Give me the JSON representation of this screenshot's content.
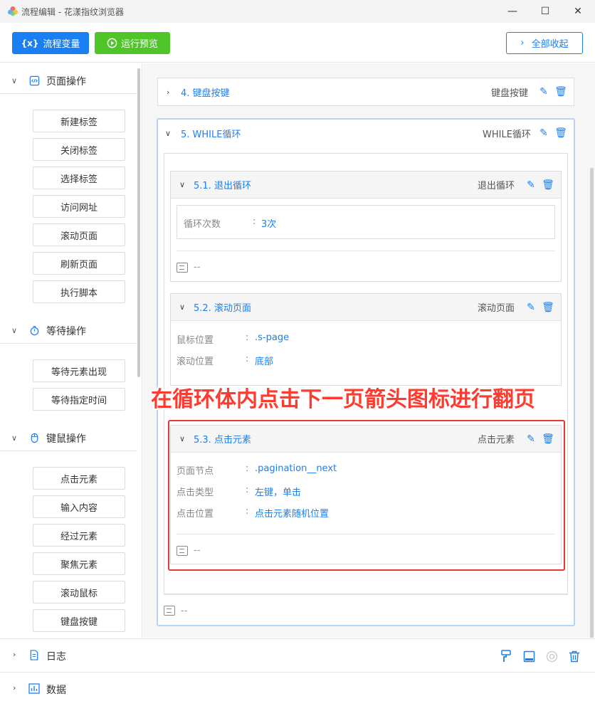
{
  "window": {
    "title": "流程编辑 - 花漾指纹浏览器",
    "minimize": "—",
    "maximize": "☐",
    "close": "✕"
  },
  "toolbar": {
    "variables_label": "流程变量",
    "variables_icon": "{x}",
    "preview_label": "运行预览",
    "collapse_label": "全部收起"
  },
  "sidebar": {
    "groups": [
      {
        "label": "页面操作",
        "icon": "code-icon",
        "items": [
          "新建标签",
          "关闭标签",
          "选择标签",
          "访问网址",
          "滚动页面",
          "刷新页面",
          "执行脚本"
        ]
      },
      {
        "label": "等待操作",
        "icon": "timer-icon",
        "items": [
          "等待元素出现",
          "等待指定时间"
        ]
      },
      {
        "label": "键鼠操作",
        "icon": "mouse-icon",
        "items": [
          "点击元素",
          "输入内容",
          "经过元素",
          "聚焦元素",
          "滚动鼠标",
          "键盘按键"
        ]
      }
    ]
  },
  "steps": {
    "step4": {
      "title": "4. 键盘按键",
      "type": "键盘按键"
    },
    "step5": {
      "title": "5. WHILE循环",
      "type": "WHILE循环",
      "comment": "--"
    },
    "step51": {
      "title": "5.1. 退出循环",
      "type": "退出循环",
      "rows": [
        {
          "label": "循环次数",
          "value": "3次"
        }
      ],
      "comment": "--"
    },
    "step52": {
      "title": "5.2. 滚动页面",
      "type": "滚动页面",
      "rows": [
        {
          "label": "鼠标位置",
          "value": ".s-page"
        },
        {
          "label": "滚动位置",
          "value": "底部"
        }
      ]
    },
    "step53": {
      "title": "5.3. 点击元素",
      "type": "点击元素",
      "rows": [
        {
          "label": "页面节点",
          "value": ".pagination__next"
        },
        {
          "label": "点击类型",
          "value": "左键，单击"
        },
        {
          "label": "点击位置",
          "value": "点击元素随机位置"
        }
      ],
      "comment": "--"
    },
    "colon": ":"
  },
  "annotation": "在循环体内点击下一页箭头图标进行翻页",
  "bottom": {
    "log_label": "日志",
    "data_label": "数据"
  },
  "colors": {
    "accent": "#1a7ff2",
    "success": "#4fc529",
    "annotation": "#ff3b30"
  }
}
